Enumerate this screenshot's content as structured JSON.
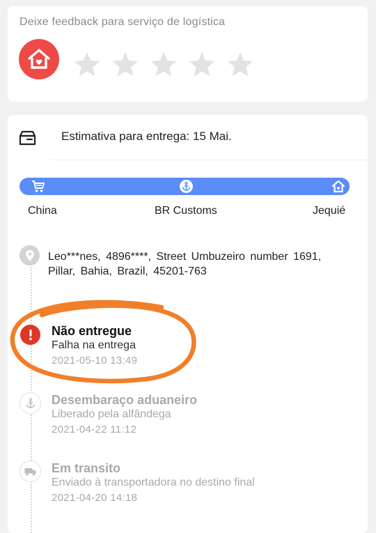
{
  "feedback": {
    "title": "Deixe feedback para serviço de logística",
    "avatar_icon": "house-heart-icon",
    "rating": 0,
    "max_rating": 5,
    "star_color": "#e3e3e3",
    "accent": "#f04a47"
  },
  "delivery": {
    "estimate": "Estimativa para entrega: 15 Mai."
  },
  "route": {
    "bar_color": "#5b8cf7",
    "origin": "China",
    "customs": "BR Customs",
    "destination": "Jequié"
  },
  "address": {
    "text": "Leo***nes, 4896****, Street Umbuzeiro number 1691, Pillar, Bahia, Brazil, 45201-763"
  },
  "events": [
    {
      "title": "Não entregue",
      "subtitle": "Falha na entrega",
      "time": "2021-05-10 13:49",
      "icon": "alert-icon",
      "status_color": "#df3726"
    },
    {
      "title": "Desembaraço aduaneiro",
      "subtitle": "Liberado pela alfândega",
      "time": "2021-04-22 11:12",
      "icon": "anchor-icon"
    },
    {
      "title": "Em transito",
      "subtitle": "Enviado à transportadora no destino final",
      "time": "2021-04-20 14:18",
      "icon": "truck-icon"
    }
  ],
  "annotation": {
    "color": "#f07f2a"
  }
}
